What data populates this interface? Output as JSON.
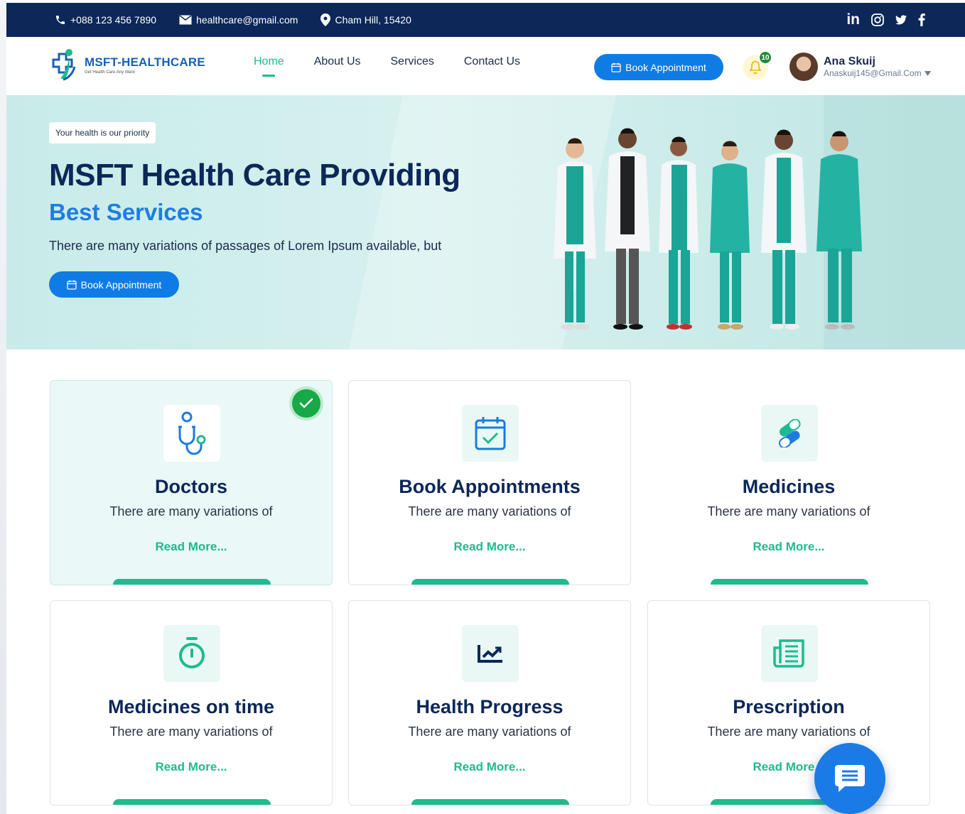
{
  "topbar": {
    "phone": "+088 123 456 7890",
    "email": "healthcare@gmail.com",
    "address": "Cham Hill, 15420",
    "socials": [
      "linkedin-icon",
      "instagram-icon",
      "twitter-icon",
      "facebook-icon"
    ]
  },
  "brand": {
    "name": "MSFT-HEALTHCARE",
    "tagline": "Get Health Care Any Ware"
  },
  "nav": {
    "items": [
      {
        "label": "Home",
        "active": true
      },
      {
        "label": "About Us",
        "active": false
      },
      {
        "label": "Services",
        "active": false
      },
      {
        "label": "Contact Us",
        "active": false
      }
    ],
    "book_label": "Book Appointment",
    "notification_count": "10"
  },
  "user": {
    "name": "Ana Skuij",
    "email": "Anaskuij145@Gmail.Com"
  },
  "hero": {
    "tag": "Your health is our priority",
    "title": "MSFT Health Care Providing",
    "subtitle": "Best Services",
    "description": "There are many variations of passages of Lorem Ipsum available, but",
    "button_label": "Book Appointment"
  },
  "services": [
    {
      "title": "Doctors",
      "description": "There are many variations of",
      "link": "Read More...",
      "icon": "stethoscope-icon",
      "selected": true
    },
    {
      "title": "Book Appointments",
      "description": "There are many variations of",
      "link": "Read More...",
      "icon": "calendar-check-icon",
      "selected": false
    },
    {
      "title": "Medicines",
      "description": "There are many variations of",
      "link": "Read More...",
      "icon": "pills-icon",
      "selected": false
    },
    {
      "title": "Medicines on time",
      "description": "There are many variations of",
      "link": "Read More...",
      "icon": "stopwatch-icon",
      "selected": false
    },
    {
      "title": "Health Progress",
      "description": "There are many variations of",
      "link": "Read More...",
      "icon": "chart-line-icon",
      "selected": false
    },
    {
      "title": "Prescription",
      "description": "There are many variations of",
      "link": "Read More...",
      "icon": "newspaper-icon",
      "selected": false
    }
  ],
  "colors": {
    "navy": "#0c2758",
    "primary_blue": "#0f7ce5",
    "accent_green": "#1dbb8e",
    "hero_bg": "#c8ebe9"
  }
}
